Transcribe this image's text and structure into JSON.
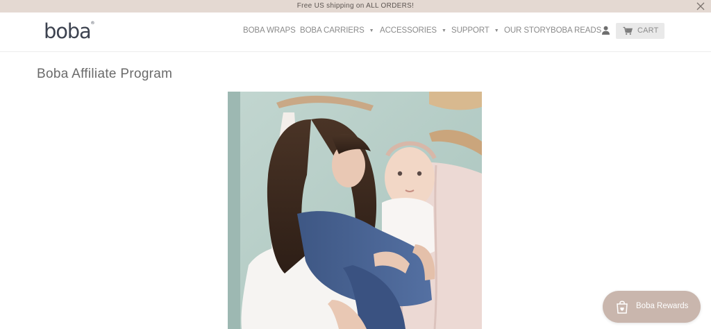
{
  "announcement": {
    "text": "Free US shipping on ALL ORDERS!"
  },
  "header": {
    "logo": "boba",
    "logo_mark": "®",
    "nav": {
      "wraps": "BOBA WRAPS",
      "carriers": "BOBA CARRIERS",
      "accessories": "ACCESSORIES",
      "support": "SUPPORT",
      "story": "OUR STORY",
      "reads": "BOBA READS"
    },
    "cart_label": "CART"
  },
  "page": {
    "title": "Boba Affiliate Program"
  },
  "rewards": {
    "label": "Boba Rewards"
  },
  "colors": {
    "announcement_bg": "#e4d9d2",
    "rewards_bg": "#c9b6ad",
    "wrap_blue": "#4d6796"
  },
  "icons": [
    "close-icon",
    "chevron-down-icon",
    "user-icon",
    "cart-icon",
    "rewards-bag-icon"
  ]
}
